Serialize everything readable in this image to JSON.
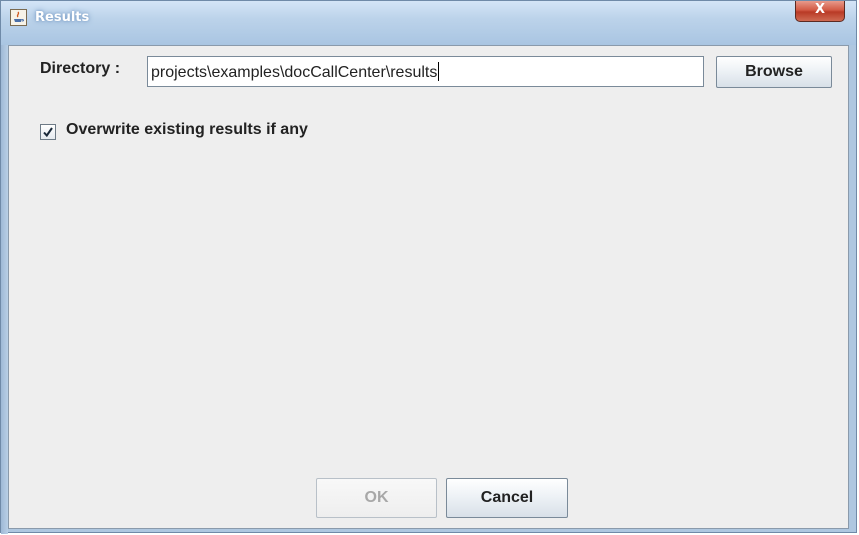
{
  "window": {
    "title": "Results",
    "close_label": "X"
  },
  "form": {
    "directory_label": "Directory :",
    "directory_value": "projects\\examples\\docCallCenter\\results",
    "browse_label": "Browse",
    "overwrite_label": "Overwrite existing results if any",
    "overwrite_checked": true
  },
  "buttons": {
    "ok_label": "OK",
    "ok_enabled": false,
    "cancel_label": "Cancel"
  },
  "icons": {
    "app": "java-app-icon",
    "check": "check-icon"
  }
}
